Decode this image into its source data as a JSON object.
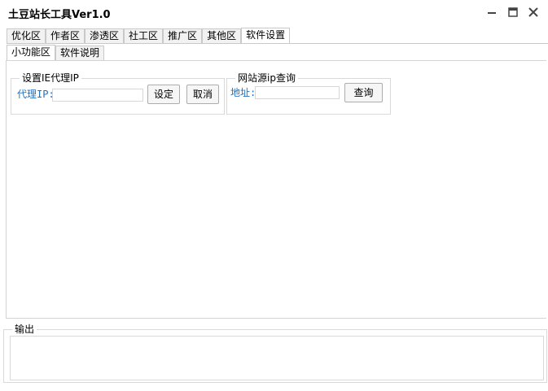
{
  "window": {
    "title": "土豆站长工具Ver1.0"
  },
  "top_tabs": [
    {
      "label": "优化区",
      "active": false
    },
    {
      "label": "作者区",
      "active": false
    },
    {
      "label": "渗透区",
      "active": false
    },
    {
      "label": "社工区",
      "active": false
    },
    {
      "label": "推广区",
      "active": false
    },
    {
      "label": "其他区",
      "active": false
    },
    {
      "label": "软件设置",
      "active": true
    }
  ],
  "sub_tabs": [
    {
      "label": "小功能区",
      "active": true
    },
    {
      "label": "软件说明",
      "active": false
    }
  ],
  "proxy_group": {
    "legend": "设置IE代理IP",
    "field_label": "代理IP:",
    "field_value": "",
    "set_label": "设定",
    "cancel_label": "取消"
  },
  "source_group": {
    "legend": "网站源ip查询",
    "field_label": "地址:",
    "field_value": "",
    "query_label": "查询"
  },
  "output_group": {
    "legend": "输出",
    "content": ""
  },
  "icons": {
    "minimize": "minimize-icon",
    "maximize": "maximize-icon",
    "close": "close-icon"
  }
}
